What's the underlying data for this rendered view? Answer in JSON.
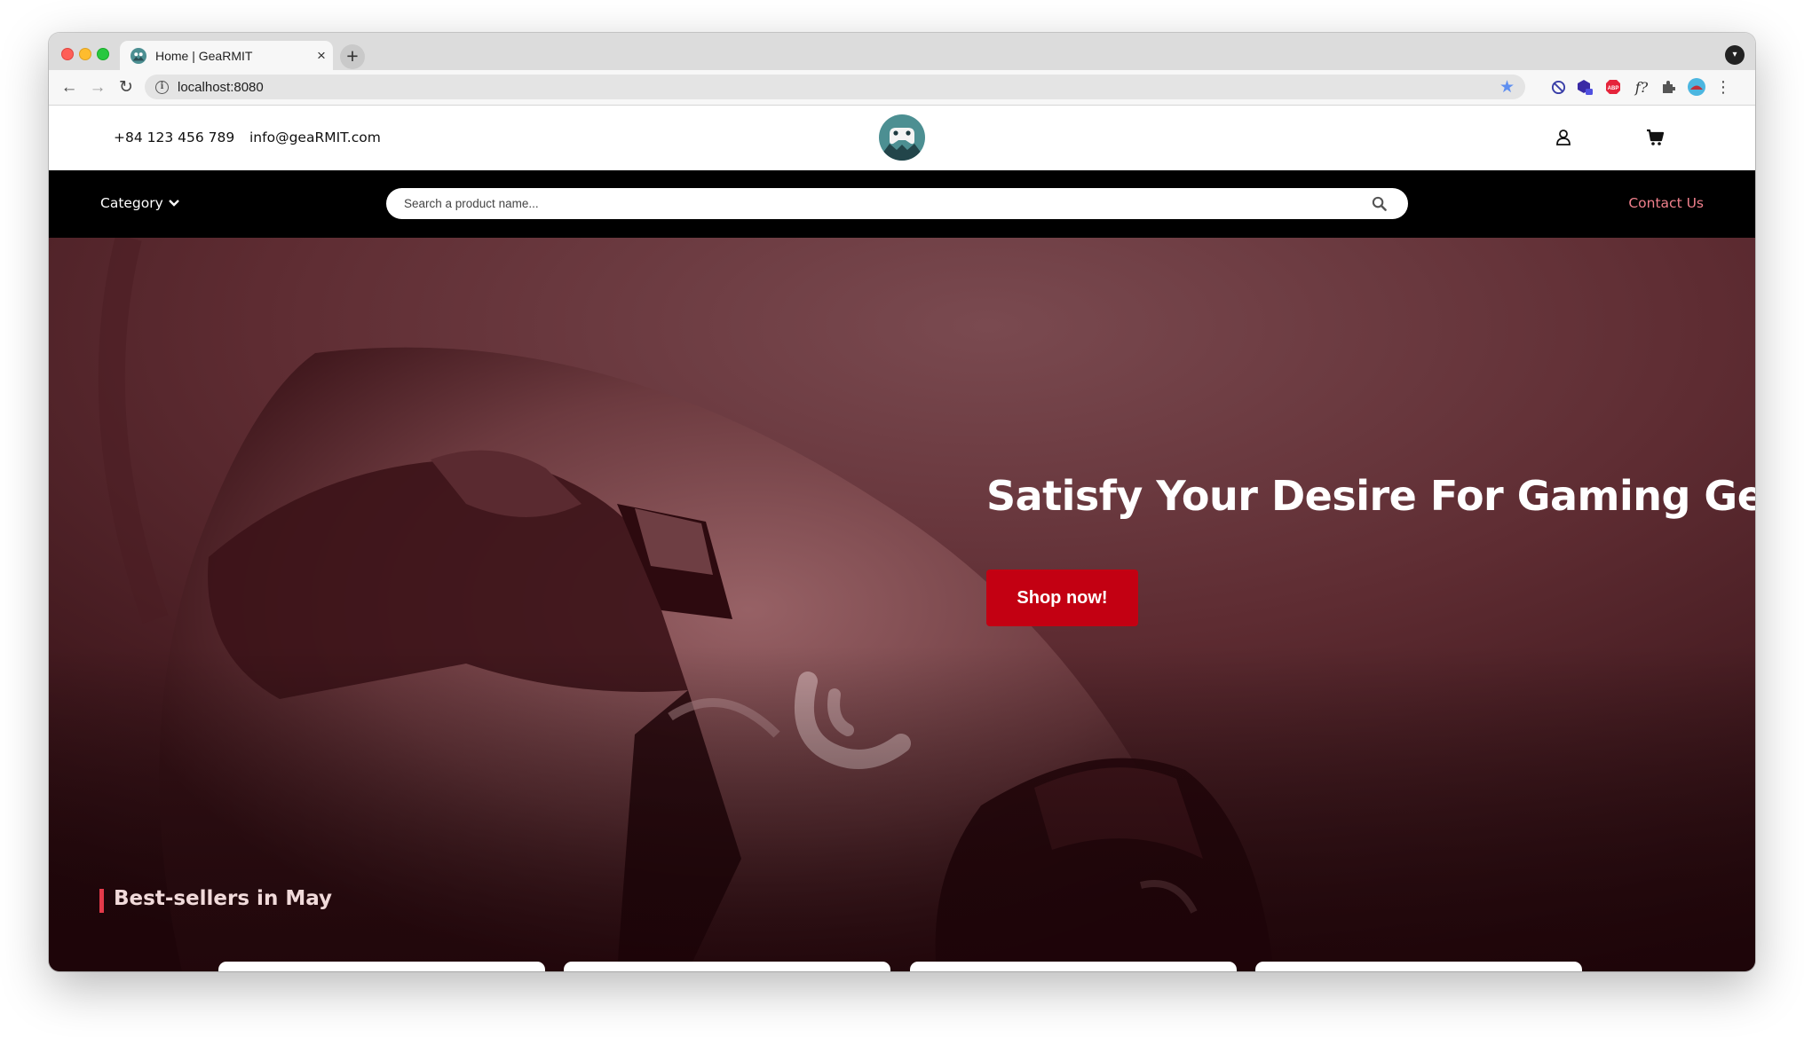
{
  "browser": {
    "tab_title": "Home | GeaRMIT",
    "tab_close": "×",
    "new_tab": "+",
    "url": "localhost:8080",
    "ext4_label": "f?"
  },
  "header": {
    "phone": "+84 123 456 789",
    "email": "info@geaRMIT.com"
  },
  "nav": {
    "category_label": "Category",
    "search_placeholder": "Search a product name...",
    "contact_label": "Contact Us"
  },
  "hero": {
    "headline": "Satisfy Your Desire For Gaming Gears",
    "cta_label": "Shop now!"
  },
  "bestsellers": {
    "title": "Best-sellers in May"
  },
  "colors": {
    "accent_red": "#c30012",
    "contact_link": "#f0808c",
    "hero_tint": "#5a272c",
    "logo_teal": "#4c8f92"
  }
}
